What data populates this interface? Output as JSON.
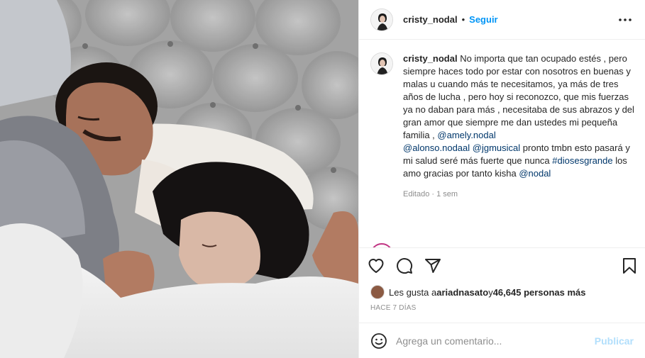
{
  "post": {
    "username": "cristy_nodal",
    "follow_label": "Seguir",
    "separator": "•",
    "caption": {
      "username": "cristy_nodal",
      "text_1": " No importa que tan ocupado estés , pero siempre haces todo por estar con nosotros en buenas y malas u cuando más te necesitamos, ya más de tres años de lucha , pero hoy si reconozco, que mis fuerzas ya no daban para más , necesitaba de sus abrazos y del gran amor que siempre me dan ustedes mi pequeña familia , ",
      "mention_1": "@amely.nodal",
      "mention_2": "@alonso.nodaal",
      "text_2": " ",
      "mention_3": "@jgmusical",
      "text_3": " pronto tmbn esto pasará y mi salud seré más fuerte que nunca ",
      "hashtag": "#diosesgrande",
      "text_4": " los amo gracias por tanto kisha ",
      "mention_4": "@nodal"
    },
    "edited_label": "Editado",
    "edited_sep": " · ",
    "edited_age": "1 sem",
    "likes": {
      "prefix": "Les gusta a ",
      "user": "ariadnasato",
      "middle": " y ",
      "count": "46,645 personas más"
    },
    "timestamp": "HACE 7 DÍAS",
    "comment_placeholder": "Agrega un comentario...",
    "publish_label": "Publicar"
  },
  "icons": [
    "more-options-icon",
    "heart-icon",
    "comment-icon",
    "share-icon",
    "bookmark-icon",
    "emoji-icon"
  ],
  "colors": {
    "link": "#0095f6",
    "mention": "#00376b",
    "muted": "#8e8e8e",
    "publish_disabled": "#b2dffc"
  }
}
